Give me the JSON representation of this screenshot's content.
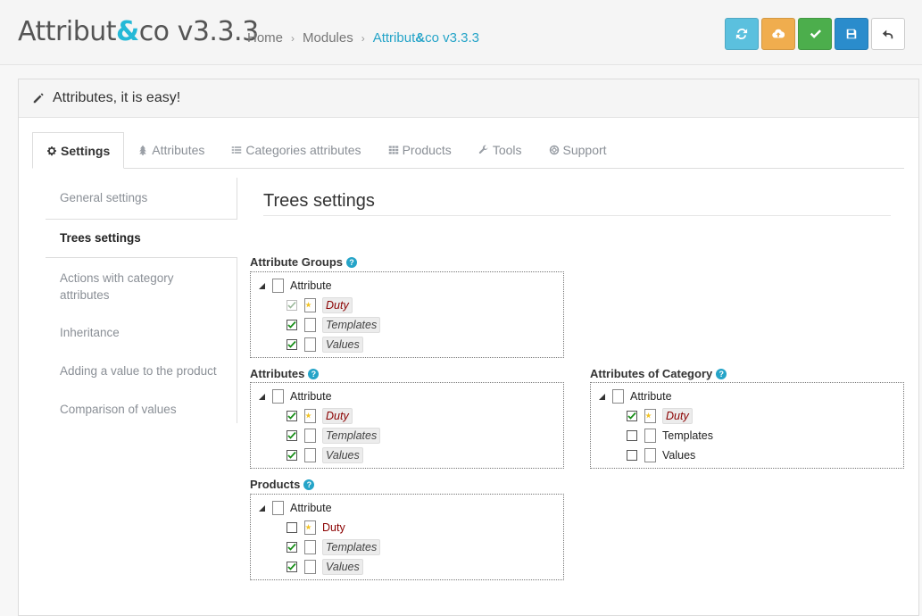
{
  "header": {
    "title_part1": "Attribut",
    "title_amp": "&",
    "title_part2": "co v3.3.3",
    "breadcrumb": {
      "home": "Home",
      "modules": "Modules",
      "current_part1": "Attribut",
      "current_amp": "&",
      "current_part2": "co v3.3.3"
    }
  },
  "toolbar": {
    "buttons": [
      {
        "icon": "refresh-icon",
        "color": "#5bc0de"
      },
      {
        "icon": "cloud-upload-icon",
        "color": "#f0ad4e"
      },
      {
        "icon": "check-icon",
        "color": "#4cae4c"
      },
      {
        "icon": "save-icon",
        "color": "#2a8ccc"
      },
      {
        "icon": "back-icon",
        "color": "#ffffff"
      }
    ]
  },
  "panel": {
    "heading": "Attributes, it is easy!"
  },
  "tabs": [
    {
      "label": "Settings",
      "icon": "gear-icon",
      "active": true
    },
    {
      "label": "Attributes",
      "icon": "tree-icon"
    },
    {
      "label": "Categories attributes",
      "icon": "list-icon"
    },
    {
      "label": "Products",
      "icon": "grid-icon"
    },
    {
      "label": "Tools",
      "icon": "wrench-icon"
    },
    {
      "label": "Support",
      "icon": "lifebuoy-icon"
    }
  ],
  "sidemenu": [
    "General settings",
    "Trees settings",
    "Actions with category attributes",
    "Inheritance",
    "Adding a value to the product",
    "Comparison of values"
  ],
  "section_title": "Trees settings",
  "trees": {
    "attribute_groups": {
      "label": "Attribute Groups",
      "root": "Attribute",
      "items": [
        "Duty",
        "Templates",
        "Values"
      ]
    },
    "attributes": {
      "label": "Attributes",
      "root": "Attribute",
      "items": [
        "Duty",
        "Templates",
        "Values"
      ]
    },
    "attributes_of_category": {
      "label": "Attributes of Category",
      "root": "Attribute",
      "items": [
        "Duty",
        "Templates",
        "Values"
      ]
    },
    "products": {
      "label": "Products",
      "root": "Attribute",
      "items": [
        "Duty",
        "Templates",
        "Values"
      ]
    }
  },
  "help_glyph": "?"
}
